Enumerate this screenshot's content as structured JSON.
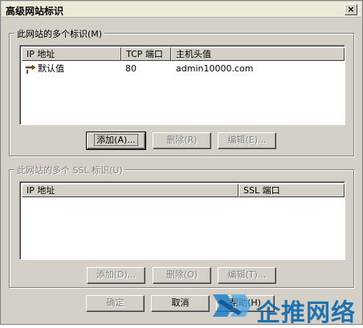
{
  "dialog": {
    "title": "高级网站标识",
    "close_glyph": "×"
  },
  "group1": {
    "legend": "此网站的多个标识(M)",
    "columns": [
      "IP 地址",
      "TCP 端口",
      "主机头值"
    ],
    "rows": [
      {
        "ip": "默认值",
        "port": "80",
        "host": "admin10000.com"
      }
    ],
    "buttons": {
      "add": "添加(A)...",
      "remove": "删除(R)",
      "edit": "编辑(E)..."
    }
  },
  "group2": {
    "legend": "此网站的多个 SSL 标识(U)",
    "columns": [
      "IP 地址",
      "SSL 端口"
    ],
    "buttons": {
      "add": "添加(D)...",
      "remove": "删除(O)",
      "edit": "编辑(T)..."
    }
  },
  "footer": {
    "ok": "确定",
    "cancel": "取消",
    "help": "帮助(H)"
  },
  "watermark": {
    "text": "企推网络",
    "color": "#0062aa"
  }
}
